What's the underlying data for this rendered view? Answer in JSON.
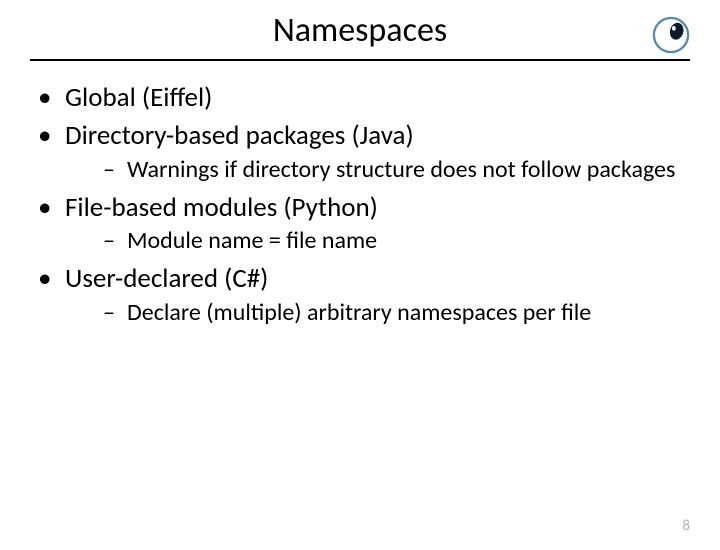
{
  "slide": {
    "title": "Namespaces",
    "bullets": [
      {
        "text": "Global (Eiffel)",
        "subs": []
      },
      {
        "text": "Directory-based packages (Java)",
        "subs": [
          "Warnings if directory structure does not follow packages"
        ]
      },
      {
        "text": "File-based modules (Python)",
        "subs": [
          "Module name = file name"
        ]
      },
      {
        "text": "User-declared (C#)",
        "subs": [
          "Declare (multiple) arbitrary namespaces per file"
        ]
      }
    ],
    "page_number": "8"
  }
}
